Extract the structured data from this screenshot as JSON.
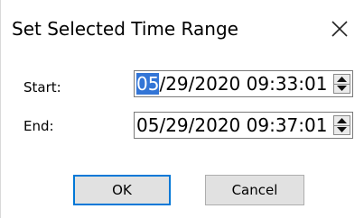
{
  "dialog": {
    "title": "Set Selected Time Range"
  },
  "fields": {
    "start_label": "Start:",
    "start_selected": "05",
    "start_rest": "/29/2020 09:33:01",
    "end_label": "End:",
    "end_value": "05/29/2020 09:37:01"
  },
  "buttons": {
    "ok_label": "OK",
    "cancel_label": "Cancel"
  },
  "colors": {
    "selection": "#3375d6",
    "ok_focus_border": "#0078d7",
    "button_bg": "#e1e1e1"
  },
  "icons": {
    "close": "close-icon",
    "spin_up": "spin-up-icon",
    "spin_down": "spin-down-icon"
  }
}
